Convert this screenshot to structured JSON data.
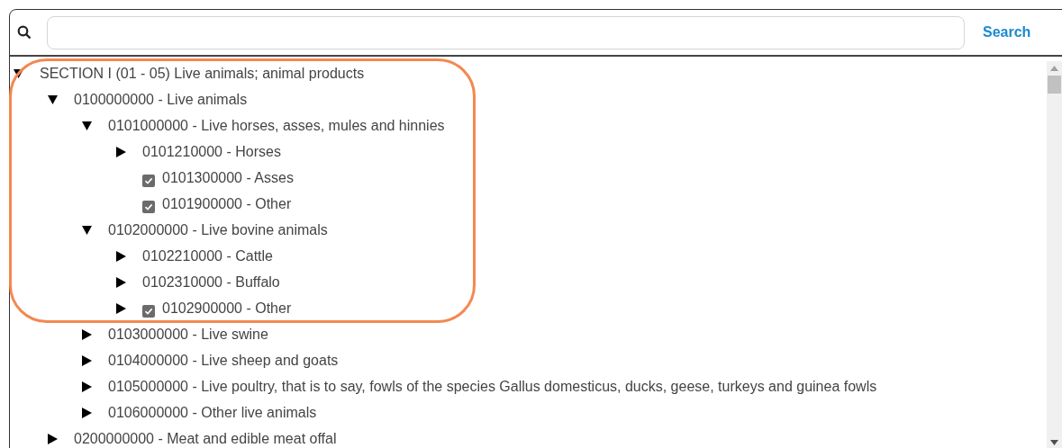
{
  "search": {
    "button": "Search"
  },
  "tree": [
    {
      "label": "SECTION I (01 - 05) Live animals; animal products",
      "expanded": true,
      "children": [
        {
          "label": "0100000000 - Live animals",
          "expanded": true,
          "children": [
            {
              "label": "0101000000 - Live horses, asses, mules and hinnies",
              "expanded": true,
              "children": [
                {
                  "label": "0101210000 - Horses",
                  "expanded": false
                },
                {
                  "label": "0101300000 - Asses",
                  "checked": true
                },
                {
                  "label": "0101900000 - Other",
                  "checked": true
                }
              ]
            },
            {
              "label": "0102000000 - Live bovine animals",
              "expanded": true,
              "children": [
                {
                  "label": "0102210000 - Cattle",
                  "expanded": false
                },
                {
                  "label": "0102310000 - Buffalo",
                  "expanded": false
                },
                {
                  "label": "0102900000 - Other",
                  "expanded": false,
                  "checked": true
                }
              ]
            },
            {
              "label": "0103000000 - Live swine",
              "expanded": false
            },
            {
              "label": "0104000000 - Live sheep and goats",
              "expanded": false
            },
            {
              "label": "0105000000 - Live poultry, that is to say, fowls of the species Gallus domesticus, ducks, geese, turkeys and guinea fowls",
              "expanded": false
            },
            {
              "label": "0106000000 - Other live animals",
              "expanded": false
            }
          ]
        },
        {
          "label": "0200000000 - Meat and edible meat offal",
          "expanded": false
        }
      ]
    }
  ]
}
